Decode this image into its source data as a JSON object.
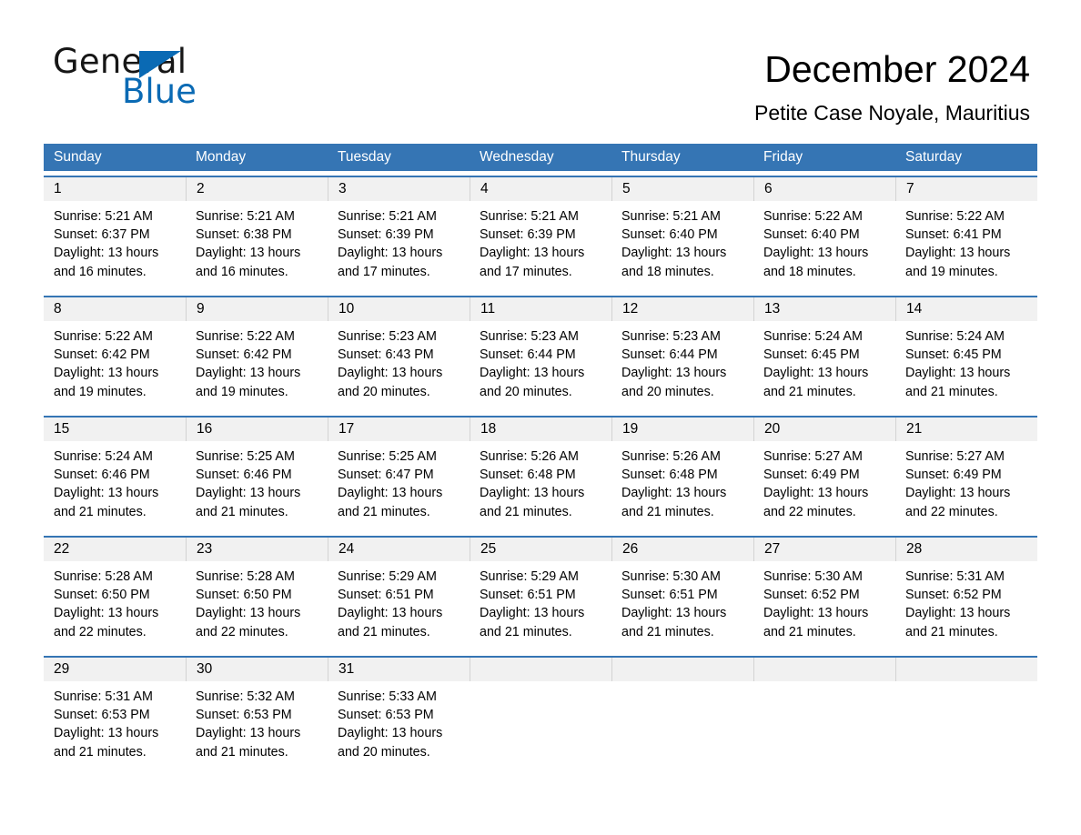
{
  "brand": {
    "name_part1": "General",
    "name_part2": "Blue",
    "triangle_color": "#0a6ab4",
    "accent_color": "#3575b4"
  },
  "header": {
    "month_title": "December 2024",
    "location": "Petite Case Noyale, Mauritius"
  },
  "weekdays": [
    "Sunday",
    "Monday",
    "Tuesday",
    "Wednesday",
    "Thursday",
    "Friday",
    "Saturday"
  ],
  "weeks": [
    [
      {
        "day": "1",
        "sunrise": "Sunrise: 5:21 AM",
        "sunset": "Sunset: 6:37 PM",
        "daylight_1": "Daylight: 13 hours",
        "daylight_2": "and 16 minutes."
      },
      {
        "day": "2",
        "sunrise": "Sunrise: 5:21 AM",
        "sunset": "Sunset: 6:38 PM",
        "daylight_1": "Daylight: 13 hours",
        "daylight_2": "and 16 minutes."
      },
      {
        "day": "3",
        "sunrise": "Sunrise: 5:21 AM",
        "sunset": "Sunset: 6:39 PM",
        "daylight_1": "Daylight: 13 hours",
        "daylight_2": "and 17 minutes."
      },
      {
        "day": "4",
        "sunrise": "Sunrise: 5:21 AM",
        "sunset": "Sunset: 6:39 PM",
        "daylight_1": "Daylight: 13 hours",
        "daylight_2": "and 17 minutes."
      },
      {
        "day": "5",
        "sunrise": "Sunrise: 5:21 AM",
        "sunset": "Sunset: 6:40 PM",
        "daylight_1": "Daylight: 13 hours",
        "daylight_2": "and 18 minutes."
      },
      {
        "day": "6",
        "sunrise": "Sunrise: 5:22 AM",
        "sunset": "Sunset: 6:40 PM",
        "daylight_1": "Daylight: 13 hours",
        "daylight_2": "and 18 minutes."
      },
      {
        "day": "7",
        "sunrise": "Sunrise: 5:22 AM",
        "sunset": "Sunset: 6:41 PM",
        "daylight_1": "Daylight: 13 hours",
        "daylight_2": "and 19 minutes."
      }
    ],
    [
      {
        "day": "8",
        "sunrise": "Sunrise: 5:22 AM",
        "sunset": "Sunset: 6:42 PM",
        "daylight_1": "Daylight: 13 hours",
        "daylight_2": "and 19 minutes."
      },
      {
        "day": "9",
        "sunrise": "Sunrise: 5:22 AM",
        "sunset": "Sunset: 6:42 PM",
        "daylight_1": "Daylight: 13 hours",
        "daylight_2": "and 19 minutes."
      },
      {
        "day": "10",
        "sunrise": "Sunrise: 5:23 AM",
        "sunset": "Sunset: 6:43 PM",
        "daylight_1": "Daylight: 13 hours",
        "daylight_2": "and 20 minutes."
      },
      {
        "day": "11",
        "sunrise": "Sunrise: 5:23 AM",
        "sunset": "Sunset: 6:44 PM",
        "daylight_1": "Daylight: 13 hours",
        "daylight_2": "and 20 minutes."
      },
      {
        "day": "12",
        "sunrise": "Sunrise: 5:23 AM",
        "sunset": "Sunset: 6:44 PM",
        "daylight_1": "Daylight: 13 hours",
        "daylight_2": "and 20 minutes."
      },
      {
        "day": "13",
        "sunrise": "Sunrise: 5:24 AM",
        "sunset": "Sunset: 6:45 PM",
        "daylight_1": "Daylight: 13 hours",
        "daylight_2": "and 21 minutes."
      },
      {
        "day": "14",
        "sunrise": "Sunrise: 5:24 AM",
        "sunset": "Sunset: 6:45 PM",
        "daylight_1": "Daylight: 13 hours",
        "daylight_2": "and 21 minutes."
      }
    ],
    [
      {
        "day": "15",
        "sunrise": "Sunrise: 5:24 AM",
        "sunset": "Sunset: 6:46 PM",
        "daylight_1": "Daylight: 13 hours",
        "daylight_2": "and 21 minutes."
      },
      {
        "day": "16",
        "sunrise": "Sunrise: 5:25 AM",
        "sunset": "Sunset: 6:46 PM",
        "daylight_1": "Daylight: 13 hours",
        "daylight_2": "and 21 minutes."
      },
      {
        "day": "17",
        "sunrise": "Sunrise: 5:25 AM",
        "sunset": "Sunset: 6:47 PM",
        "daylight_1": "Daylight: 13 hours",
        "daylight_2": "and 21 minutes."
      },
      {
        "day": "18",
        "sunrise": "Sunrise: 5:26 AM",
        "sunset": "Sunset: 6:48 PM",
        "daylight_1": "Daylight: 13 hours",
        "daylight_2": "and 21 minutes."
      },
      {
        "day": "19",
        "sunrise": "Sunrise: 5:26 AM",
        "sunset": "Sunset: 6:48 PM",
        "daylight_1": "Daylight: 13 hours",
        "daylight_2": "and 21 minutes."
      },
      {
        "day": "20",
        "sunrise": "Sunrise: 5:27 AM",
        "sunset": "Sunset: 6:49 PM",
        "daylight_1": "Daylight: 13 hours",
        "daylight_2": "and 22 minutes."
      },
      {
        "day": "21",
        "sunrise": "Sunrise: 5:27 AM",
        "sunset": "Sunset: 6:49 PM",
        "daylight_1": "Daylight: 13 hours",
        "daylight_2": "and 22 minutes."
      }
    ],
    [
      {
        "day": "22",
        "sunrise": "Sunrise: 5:28 AM",
        "sunset": "Sunset: 6:50 PM",
        "daylight_1": "Daylight: 13 hours",
        "daylight_2": "and 22 minutes."
      },
      {
        "day": "23",
        "sunrise": "Sunrise: 5:28 AM",
        "sunset": "Sunset: 6:50 PM",
        "daylight_1": "Daylight: 13 hours",
        "daylight_2": "and 22 minutes."
      },
      {
        "day": "24",
        "sunrise": "Sunrise: 5:29 AM",
        "sunset": "Sunset: 6:51 PM",
        "daylight_1": "Daylight: 13 hours",
        "daylight_2": "and 21 minutes."
      },
      {
        "day": "25",
        "sunrise": "Sunrise: 5:29 AM",
        "sunset": "Sunset: 6:51 PM",
        "daylight_1": "Daylight: 13 hours",
        "daylight_2": "and 21 minutes."
      },
      {
        "day": "26",
        "sunrise": "Sunrise: 5:30 AM",
        "sunset": "Sunset: 6:51 PM",
        "daylight_1": "Daylight: 13 hours",
        "daylight_2": "and 21 minutes."
      },
      {
        "day": "27",
        "sunrise": "Sunrise: 5:30 AM",
        "sunset": "Sunset: 6:52 PM",
        "daylight_1": "Daylight: 13 hours",
        "daylight_2": "and 21 minutes."
      },
      {
        "day": "28",
        "sunrise": "Sunrise: 5:31 AM",
        "sunset": "Sunset: 6:52 PM",
        "daylight_1": "Daylight: 13 hours",
        "daylight_2": "and 21 minutes."
      }
    ],
    [
      {
        "day": "29",
        "sunrise": "Sunrise: 5:31 AM",
        "sunset": "Sunset: 6:53 PM",
        "daylight_1": "Daylight: 13 hours",
        "daylight_2": "and 21 minutes."
      },
      {
        "day": "30",
        "sunrise": "Sunrise: 5:32 AM",
        "sunset": "Sunset: 6:53 PM",
        "daylight_1": "Daylight: 13 hours",
        "daylight_2": "and 21 minutes."
      },
      {
        "day": "31",
        "sunrise": "Sunrise: 5:33 AM",
        "sunset": "Sunset: 6:53 PM",
        "daylight_1": "Daylight: 13 hours",
        "daylight_2": "and 20 minutes."
      },
      {
        "day": "",
        "sunrise": "",
        "sunset": "",
        "daylight_1": "",
        "daylight_2": ""
      },
      {
        "day": "",
        "sunrise": "",
        "sunset": "",
        "daylight_1": "",
        "daylight_2": ""
      },
      {
        "day": "",
        "sunrise": "",
        "sunset": "",
        "daylight_1": "",
        "daylight_2": ""
      },
      {
        "day": "",
        "sunrise": "",
        "sunset": "",
        "daylight_1": "",
        "daylight_2": ""
      }
    ]
  ]
}
